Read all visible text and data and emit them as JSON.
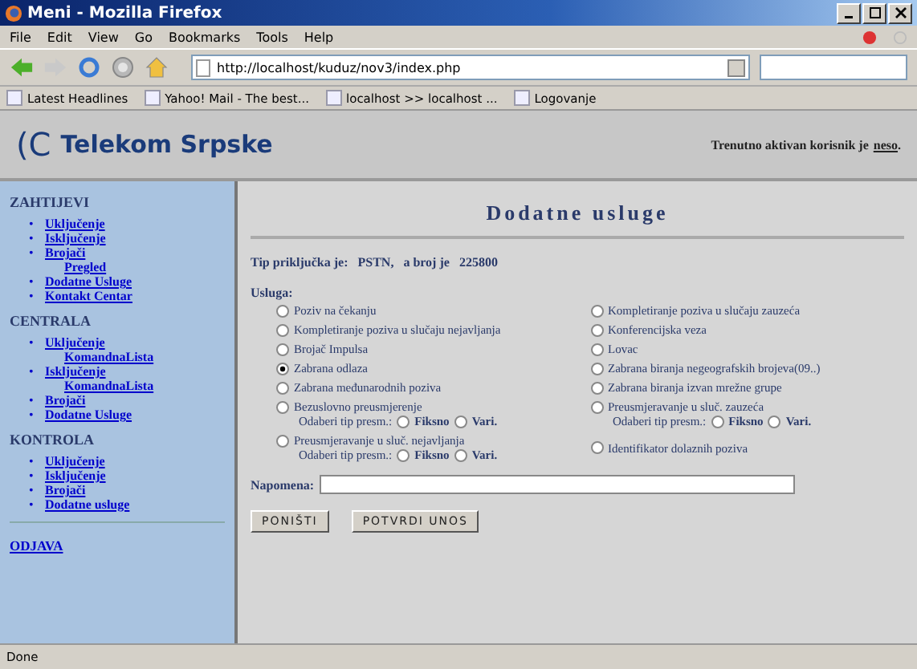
{
  "window": {
    "title": "Meni - Mozilla Firefox"
  },
  "menu": [
    "File",
    "Edit",
    "View",
    "Go",
    "Bookmarks",
    "Tools",
    "Help"
  ],
  "address": "http://localhost/kuduz/nov3/index.php",
  "bookmarks": [
    "Latest Headlines",
    "Yahoo! Mail - The best...",
    "localhost >> localhost ...",
    "Logovanje"
  ],
  "header": {
    "logo_mark": "(C",
    "logo_text": "Telekom Srpske",
    "user_text": "Trenutno aktivan korisnik je",
    "user_name": "neso",
    "user_end": "."
  },
  "sidebar": [
    {
      "title": "ZAHTIJEVI",
      "bullet": "•",
      "items": [
        {
          "label": "Uključenje"
        },
        {
          "label": "Isključenje"
        },
        {
          "label": "Brojači",
          "children": [
            {
              "label": "Pregled"
            }
          ]
        },
        {
          "label": "Dodatne Usluge"
        },
        {
          "label": "Kontakt Centar"
        }
      ]
    },
    {
      "title": "CENTRALA",
      "bullet": "•",
      "items": [
        {
          "label": "Uključenje",
          "children": [
            {
              "label": "KomandnaLista"
            }
          ]
        },
        {
          "label": "Isključenje",
          "children": [
            {
              "label": "KomandnaLista"
            }
          ]
        },
        {
          "label": "Brojači"
        },
        {
          "label": "Dodatne Usluge"
        }
      ]
    },
    {
      "title": "KONTROLA",
      "bullet": "•",
      "items": [
        {
          "label": "Uključenje"
        },
        {
          "label": "Isključenje"
        },
        {
          "label": "Brojači"
        },
        {
          "label": "Dodatne usluge"
        }
      ]
    }
  ],
  "logout": "ODJAVA",
  "page_title": "Dodatne usluge",
  "connection": {
    "label": "Tip priključka je:",
    "type": "PSTN,",
    "number_label": "a broj je",
    "number": "225800"
  },
  "services_label": "Usluga:",
  "services": [
    {
      "kind": "plain",
      "label": "Poziv na čekanju",
      "selected": false
    },
    {
      "kind": "plain",
      "label": "Kompletiranje poziva u slučaju zauzeća",
      "selected": false
    },
    {
      "kind": "plain",
      "label": "Kompletiranje poziva u slučaju nejavljanja",
      "selected": false
    },
    {
      "kind": "plain",
      "label": "Konferencijska veza",
      "selected": false
    },
    {
      "kind": "plain",
      "label": "Brojač Impulsa",
      "selected": false
    },
    {
      "kind": "plain",
      "label": "Lovac",
      "selected": false
    },
    {
      "kind": "plain",
      "label": "Zabrana odlaza",
      "selected": true
    },
    {
      "kind": "plain",
      "label": "Zabrana biranja negeografskih brojeva(09..)",
      "selected": false
    },
    {
      "kind": "plain",
      "label": "Zabrana međunarodnih poziva",
      "selected": false
    },
    {
      "kind": "plain",
      "label": "Zabrana biranja izvan mrežne grupe",
      "selected": false
    },
    {
      "kind": "redirect",
      "label": "Bezuslovno preusmjerenje",
      "selected": false,
      "prompt": "Odaberi tip presm.:",
      "options": [
        {
          "label": "Fiksno",
          "selected": false
        },
        {
          "label": "Vari.",
          "selected": false
        }
      ]
    },
    {
      "kind": "redirect",
      "label": "Preusmjeravanje u sluč. zauzeća",
      "selected": false,
      "prompt": "Odaberi tip presm.:",
      "options": [
        {
          "label": "Fiksno",
          "selected": false
        },
        {
          "label": "Vari.",
          "selected": false
        }
      ]
    },
    {
      "kind": "redirect",
      "label": "Preusmjeravanje u sluč. nejavljanja",
      "selected": false,
      "prompt": "Odaberi tip presm.:",
      "options": [
        {
          "label": "Fiksno",
          "selected": false
        },
        {
          "label": "Vari.",
          "selected": false
        }
      ]
    },
    {
      "kind": "plain",
      "label": "Identifikator dolaznih poziva",
      "selected": false
    }
  ],
  "note_label": "Napomena:",
  "buttons": [
    "PONIŠTI",
    "POTVRDI UNOS"
  ],
  "status_bar": "Done"
}
